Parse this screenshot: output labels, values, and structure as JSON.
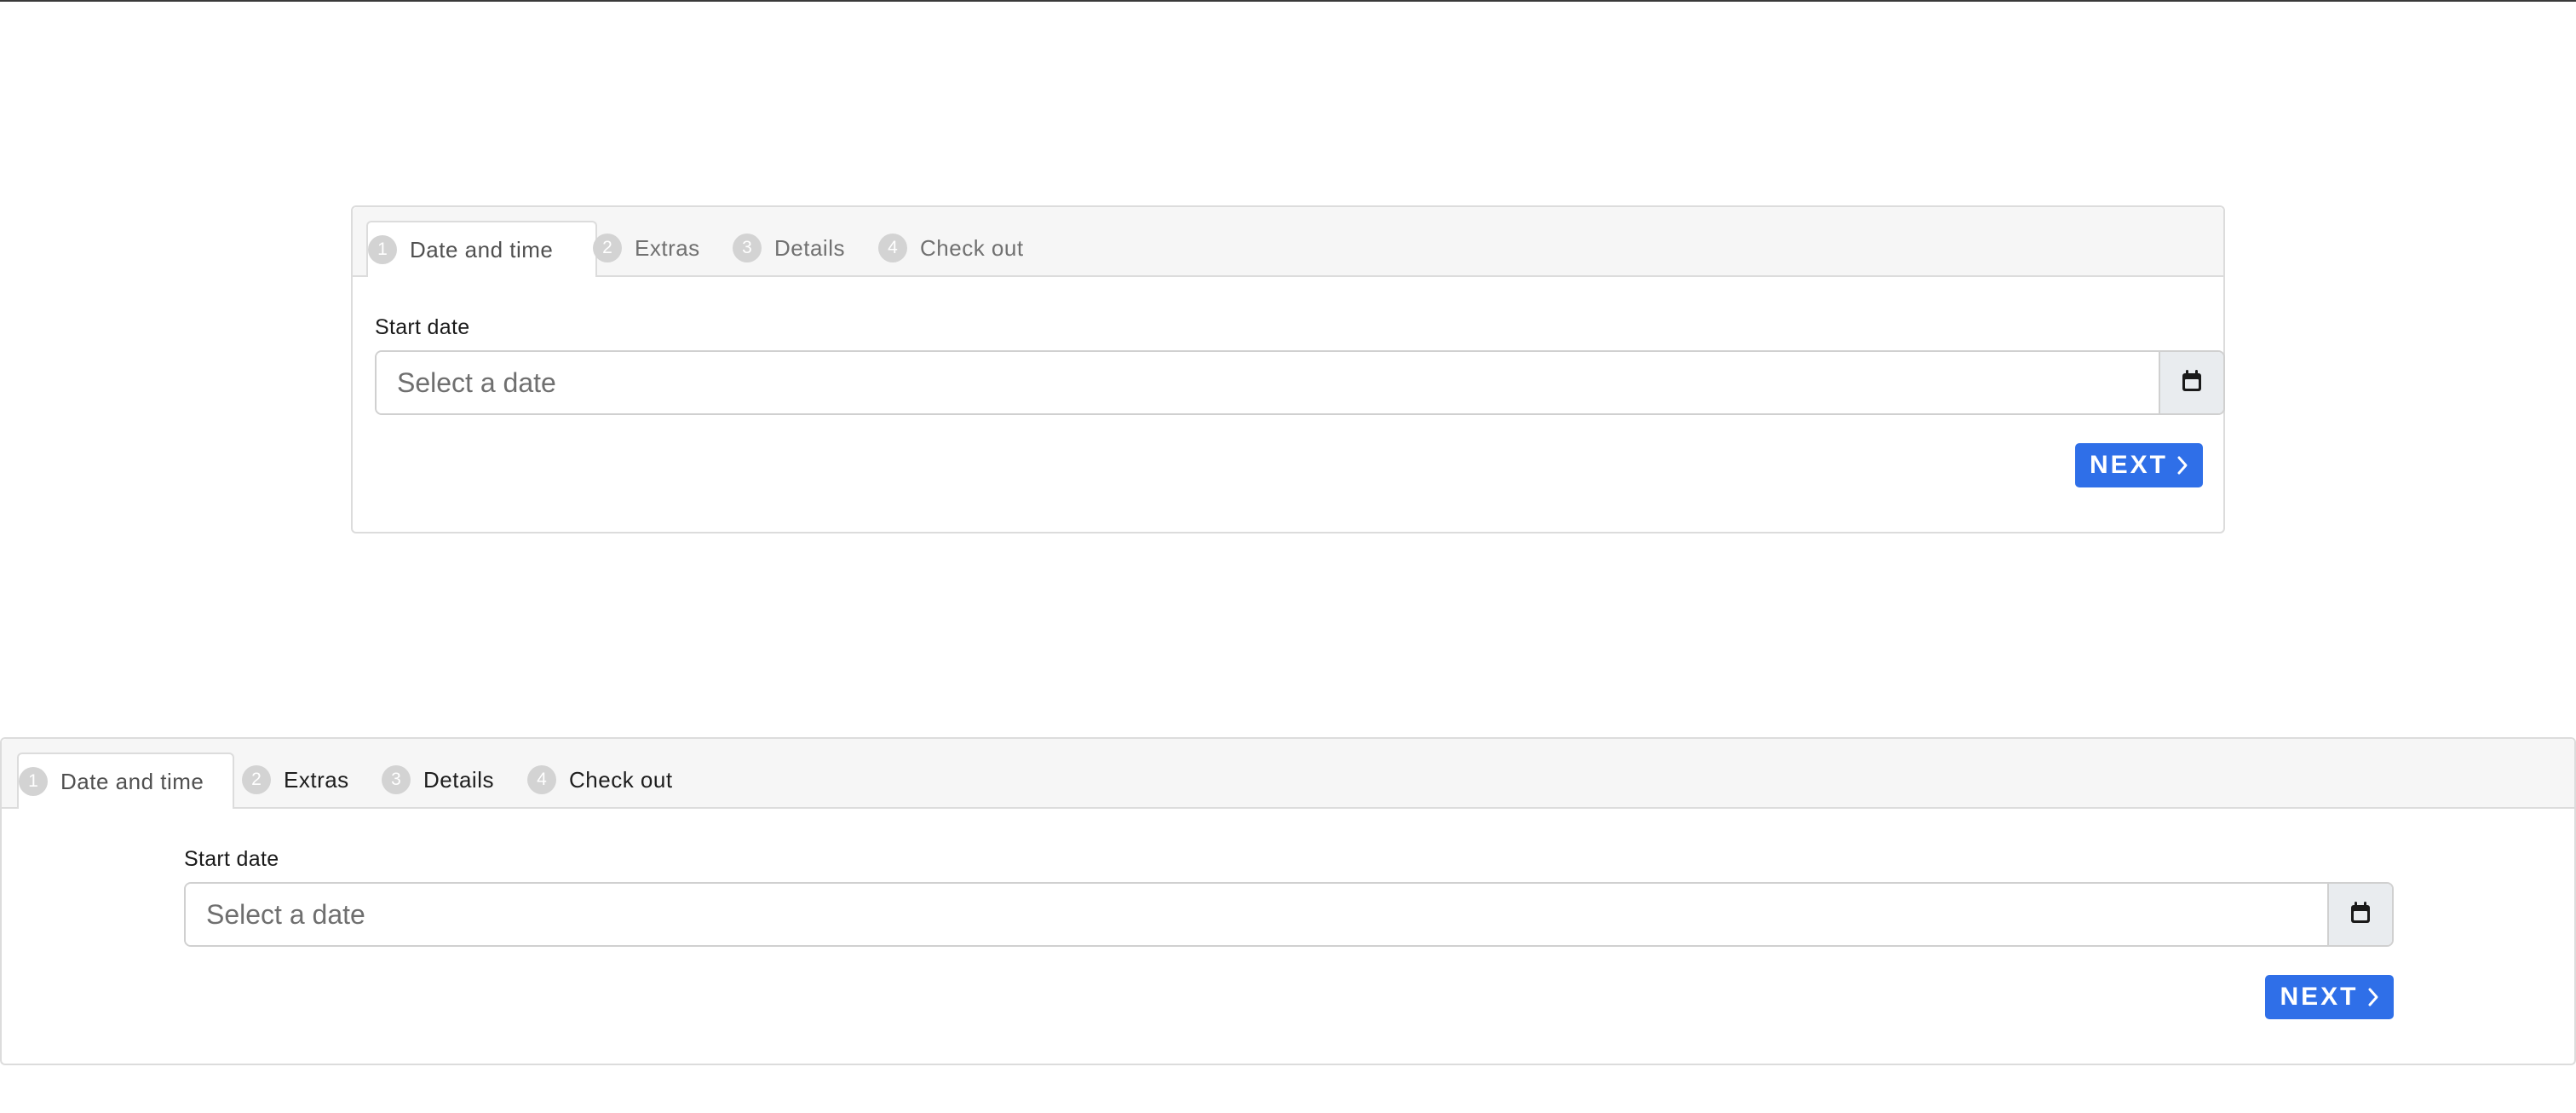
{
  "wizards": [
    {
      "tabs": [
        {
          "number": "1",
          "label": "Date and time"
        },
        {
          "number": "2",
          "label": "Extras"
        },
        {
          "number": "3",
          "label": "Details"
        },
        {
          "number": "4",
          "label": "Check out"
        }
      ],
      "active_tab": "Date and time",
      "field_label": "Start date",
      "input_value": "",
      "input_placeholder": "Select a date",
      "next_label": "NEXT"
    },
    {
      "tabs": [
        {
          "number": "1",
          "label": "Date and time"
        },
        {
          "number": "2",
          "label": "Extras"
        },
        {
          "number": "3",
          "label": "Details"
        },
        {
          "number": "4",
          "label": "Check out"
        }
      ],
      "active_tab": "Date and time",
      "field_label": "Start date",
      "input_value": "",
      "input_placeholder": "Select a date",
      "next_label": "NEXT"
    }
  ],
  "icons": {
    "calendar": "calendar-icon",
    "next": "chevron-right-icon"
  },
  "colors": {
    "primary": "#2f6fe8",
    "tab_number_bg": "#d3d3d3",
    "tab_bar_bg": "#f6f6f6",
    "border": "#dcdcdc"
  }
}
